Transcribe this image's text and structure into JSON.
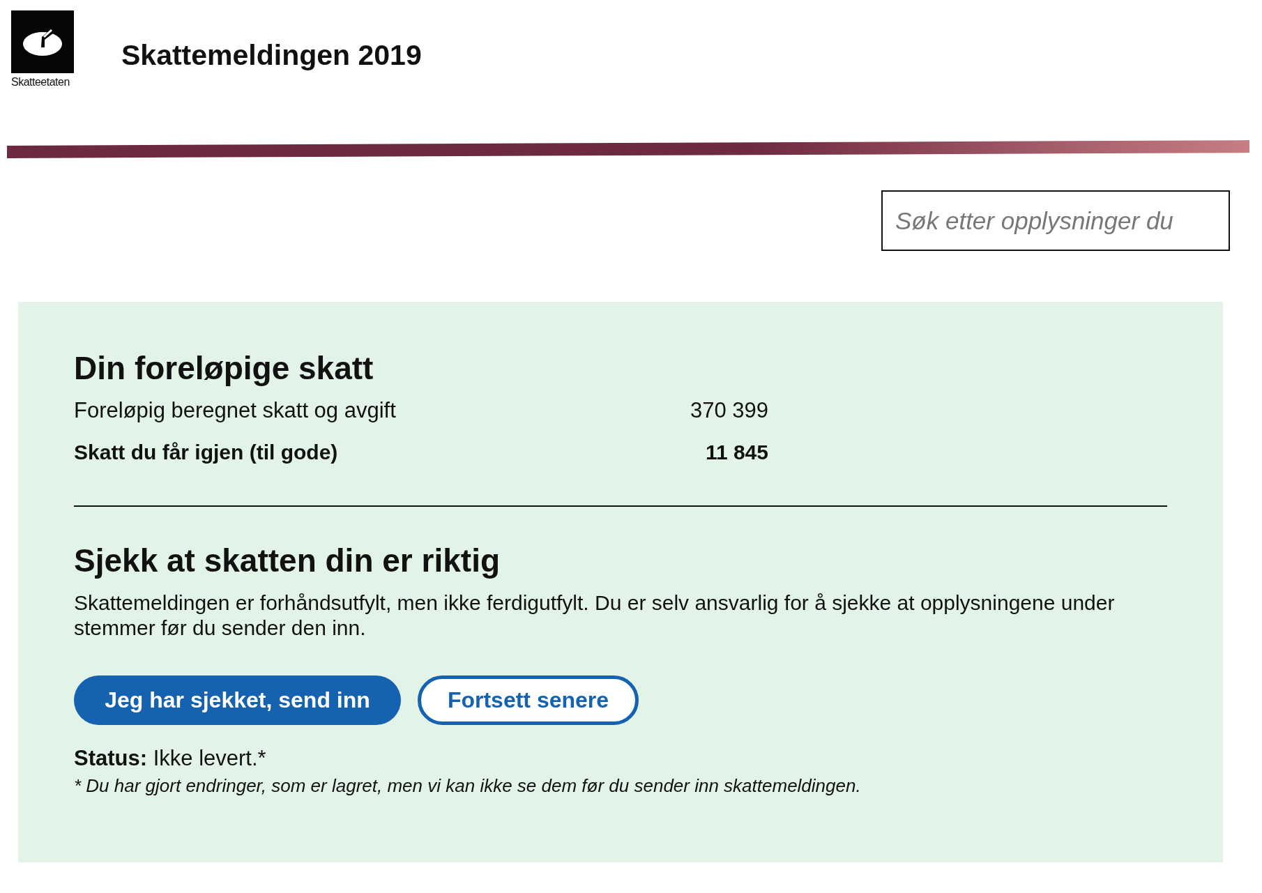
{
  "header": {
    "logo_text": "Skatteetaten",
    "title": "Skattemeldingen 2019"
  },
  "search": {
    "placeholder": "Søk etter opplysninger du"
  },
  "summary": {
    "heading": "Din foreløpige skatt",
    "rows": [
      {
        "label": "Foreløpig beregnet skatt og avgift",
        "value": "370 399",
        "kind": "normal"
      },
      {
        "label": "Skatt du får igjen (til gode)",
        "value": "11 845",
        "kind": "total"
      }
    ]
  },
  "check": {
    "heading": "Sjekk at skatten din er riktig",
    "text": "Skattemeldingen er forhåndsutfylt, men ikke ferdigutfylt. Du er selv ansvarlig for å sjekke at opplysningene under stemmer før du sender den inn.",
    "buttons": [
      {
        "label": "Jeg har sjekket, send inn",
        "kind": "primary"
      },
      {
        "label": "Fortsett senere",
        "kind": "secondary"
      }
    ],
    "status": "**Status:** Ikke levert.*",
    "footnote": "* Du har gjort endringer, som er lagret, men vi kan ikke se dem før du sender inn skattemeldingen."
  }
}
